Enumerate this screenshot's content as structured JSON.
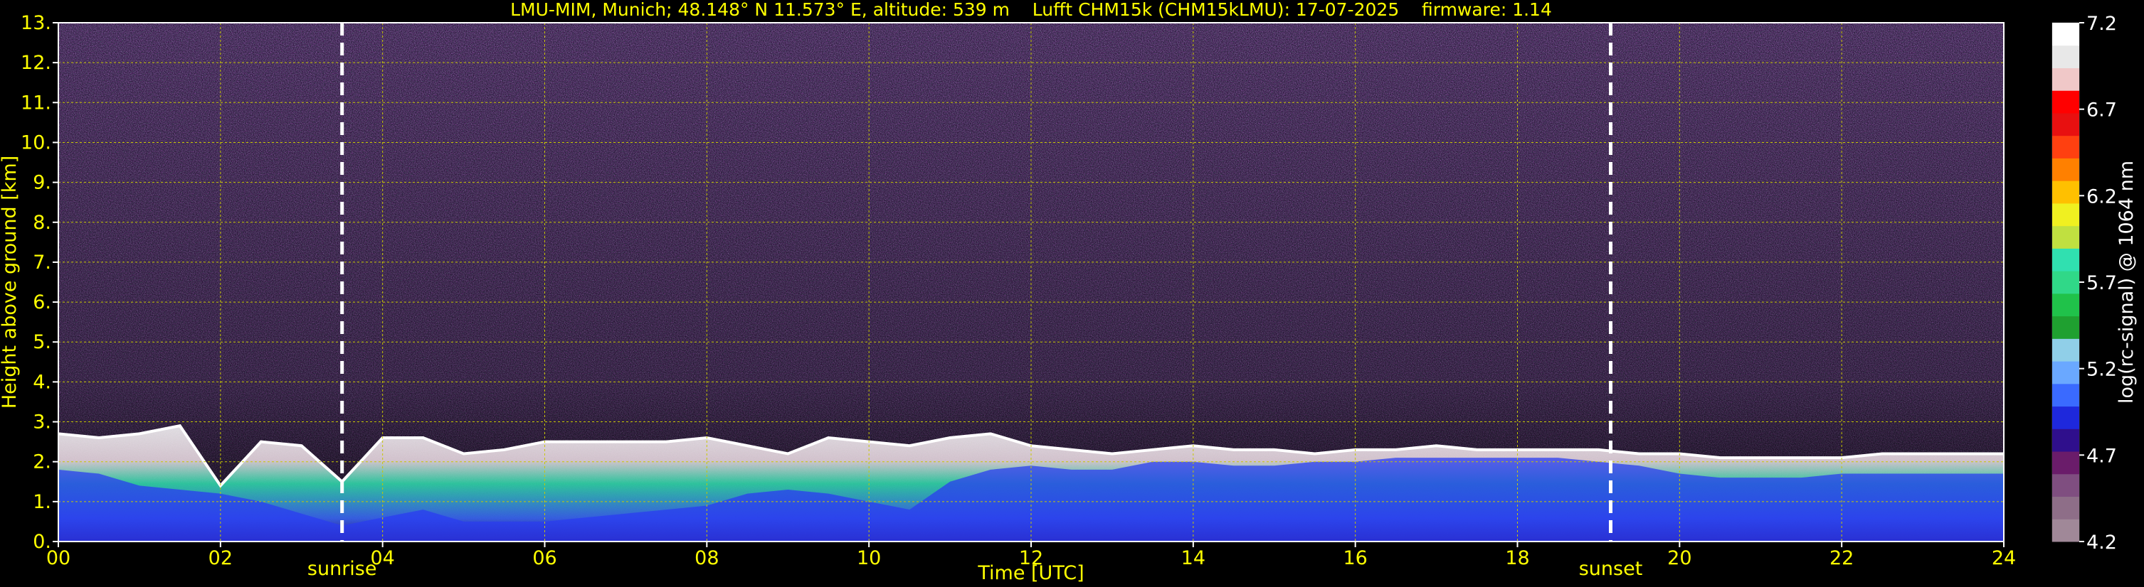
{
  "chart_data": {
    "type": "heatmap",
    "title": "LMU-MIM, Munich; 48.148° N 11.573° E, altitude: 539 m    Lufft CHM15k (CHM15kLMU): 17-07-2025    firmware: 1.14",
    "xlabel": "Time [UTC]",
    "ylabel": "Height above ground [km]",
    "xlim": [
      0,
      24
    ],
    "ylim": [
      0,
      13
    ],
    "x_ticks": [
      "00",
      "02",
      "04",
      "06",
      "08",
      "10",
      "12",
      "14",
      "16",
      "18",
      "20",
      "22",
      "24"
    ],
    "x_tick_values": [
      0,
      2,
      4,
      6,
      8,
      10,
      12,
      14,
      16,
      18,
      20,
      22,
      24
    ],
    "y_ticks": [
      "0.",
      "1.",
      "2.",
      "3.",
      "4.",
      "5.",
      "6.",
      "7.",
      "8.",
      "9.",
      "10.",
      "11.",
      "12.",
      "13."
    ],
    "y_tick_values": [
      0,
      1,
      2,
      3,
      4,
      5,
      6,
      7,
      8,
      9,
      10,
      11,
      12,
      13
    ],
    "grid": true,
    "annotations": [
      {
        "label": "sunrise",
        "time": 3.5
      },
      {
        "label": "sunset",
        "time": 19.15
      }
    ],
    "colorbar": {
      "label": "log(rc-signal) @ 1064 nm",
      "range": [
        4.2,
        7.2
      ],
      "ticks": [
        "4.2",
        "4.7",
        "5.2",
        "5.7",
        "6.2",
        "6.7",
        "7.2"
      ],
      "tick_values": [
        4.2,
        4.7,
        5.2,
        5.7,
        6.2,
        6.7,
        7.2
      ],
      "colors": [
        "#a08898",
        "#8e6e88",
        "#7f4e80",
        "#6a1c6a",
        "#2f0f8c",
        "#1e28dc",
        "#3a6aff",
        "#6aa8ff",
        "#90cfe8",
        "#1fa030",
        "#20c24a",
        "#30d888",
        "#30e0b0",
        "#c0e040",
        "#f0f020",
        "#ffc000",
        "#ff8000",
        "#ff4010",
        "#e81010",
        "#ff0000",
        "#f0c8c8",
        "#e8e8e8",
        "#ffffff"
      ]
    },
    "series": [
      {
        "time": [
          0,
          0.5,
          1,
          1.5,
          2,
          2.5,
          3,
          3.5,
          4,
          4.5,
          5,
          5.5,
          6,
          6.5,
          7,
          7.5,
          8,
          8.5,
          9,
          9.5,
          10,
          10.5,
          11,
          11.5,
          12,
          12.5,
          13,
          13.5,
          14,
          14.5,
          15,
          15.5,
          16,
          16.5,
          17,
          17.5,
          18,
          18.5,
          19,
          19.5,
          20,
          20.5,
          21,
          21.5,
          22,
          22.5,
          23,
          23.5,
          24
        ],
        "cloud_top_km": [
          2.7,
          2.6,
          2.7,
          2.9,
          1.4,
          2.5,
          2.4,
          1.5,
          2.6,
          2.6,
          2.2,
          2.3,
          2.5,
          2.5,
          2.5,
          2.5,
          2.6,
          2.4,
          2.2,
          2.6,
          2.5,
          2.4,
          2.6,
          2.7,
          2.4,
          2.3,
          2.2,
          2.3,
          2.4,
          2.3,
          2.3,
          2.2,
          2.3,
          2.3,
          2.4,
          2.3,
          2.3,
          2.3,
          2.3,
          2.2,
          2.2,
          2.1,
          2.1,
          2.1,
          2.1,
          2.2,
          2.2,
          2.2,
          2.2
        ],
        "mixing_top_km": [
          1.8,
          1.7,
          1.4,
          1.3,
          1.2,
          1.0,
          0.7,
          0.4,
          0.6,
          0.8,
          0.5,
          0.5,
          0.5,
          0.6,
          0.7,
          0.8,
          0.9,
          1.2,
          1.3,
          1.2,
          1.0,
          0.8,
          1.5,
          1.8,
          1.9,
          1.8,
          1.8,
          2.0,
          2.0,
          1.9,
          1.9,
          2.0,
          2.0,
          2.1,
          2.1,
          2.1,
          2.1,
          2.1,
          2.0,
          1.9,
          1.7,
          1.6,
          1.6,
          1.6,
          1.7,
          1.7,
          1.7,
          1.7,
          1.7
        ]
      }
    ]
  }
}
